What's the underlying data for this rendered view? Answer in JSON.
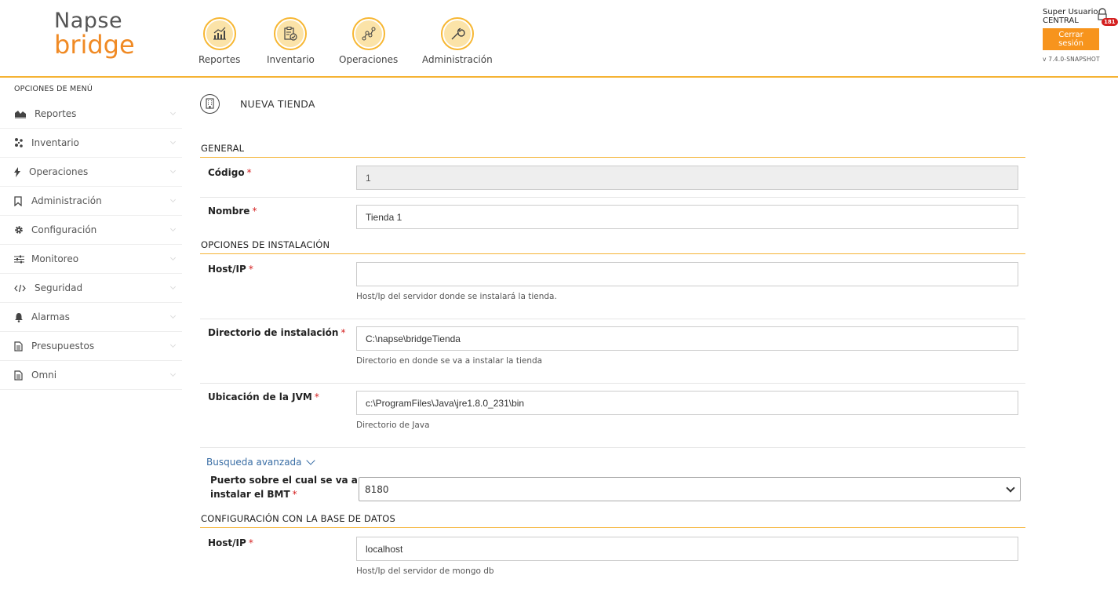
{
  "logo": {
    "line1": "Napse",
    "line2": "bridge"
  },
  "topnav": [
    {
      "label": "Reportes",
      "icon": "chart-icon"
    },
    {
      "label": "Inventario",
      "icon": "clipboard-check-icon"
    },
    {
      "label": "Operaciones",
      "icon": "nodes-icon"
    },
    {
      "label": "Administración",
      "icon": "wrench-icon"
    }
  ],
  "user": {
    "name": "Super Usuario",
    "store": "CENTRAL",
    "badge": "181",
    "logout_label": "Cerrar sesión",
    "version": "v 7.4.0-SNAPSHOT"
  },
  "sidebar": {
    "title": "OPCIONES DE MENÚ",
    "items": [
      {
        "label": "Reportes",
        "icon": "area-chart-icon"
      },
      {
        "label": "Inventario",
        "icon": "cubes-icon"
      },
      {
        "label": "Operaciones",
        "icon": "bolt-icon"
      },
      {
        "label": "Administración",
        "icon": "bookmark-icon"
      },
      {
        "label": "Configuración",
        "icon": "gear-icon"
      },
      {
        "label": "Monitoreo",
        "icon": "sliders-icon"
      },
      {
        "label": "Seguridad",
        "icon": "code-icon"
      },
      {
        "label": "Alarmas",
        "icon": "bell-icon"
      },
      {
        "label": "Presupuestos",
        "icon": "document-icon"
      },
      {
        "label": "Omni",
        "icon": "document-icon"
      }
    ]
  },
  "page": {
    "title": "NUEVA TIENDA",
    "icon": "building-icon"
  },
  "sections": {
    "general": "GENERAL",
    "install": "OPCIONES DE INSTALACIÓN",
    "db": "CONFIGURACIÓN CON LA BASE DE DATOS"
  },
  "fields": {
    "codigo": {
      "label": "Código",
      "value": "1"
    },
    "nombre": {
      "label": "Nombre",
      "value": "Tienda 1"
    },
    "host": {
      "label": "Host/IP",
      "value": "",
      "help": "Host/Ip del servidor donde se instalará la tienda."
    },
    "dir": {
      "label": "Directorio de instalación",
      "value": "C:\\napse\\bridgeTienda",
      "help": "Directorio en donde se va a instalar la tienda"
    },
    "jvm": {
      "label": "Ubicación de la JVM",
      "value": "c:\\ProgramFiles\\Java\\jre1.8.0_231\\bin",
      "help": "Directorio de Java"
    },
    "advanced_label": "Busqueda avanzada",
    "port": {
      "label_line1": "Puerto sobre el cual se va a",
      "label_line2": "instalar el BMT",
      "value": "8180"
    },
    "dbhost": {
      "label": "Host/IP",
      "value": "localhost",
      "help": "Host/Ip del servidor de mongo db"
    }
  },
  "required_mark": "*",
  "colors": {
    "accent": "#f5b334",
    "orange": "#f7941d",
    "link": "#3a6ea5",
    "required": "#d42020"
  }
}
